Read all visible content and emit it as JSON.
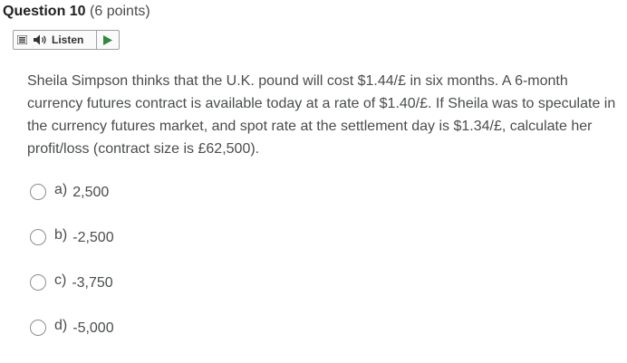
{
  "question": {
    "title": "Question 10",
    "points": "(6 points)",
    "text": "Sheila Simpson thinks that the U.K. pound will cost $1.44/£ in six months. A 6-month currency futures contract is available today at a rate of $1.40/£. If Sheila was to speculate in the currency futures market, and spot rate at the settlement day is $1.34/£, calculate her profit/loss (contract size is £62,500)."
  },
  "listen_bar": {
    "label": "Listen",
    "menu_icon": "menu-icon",
    "speaker_icon": "speaker-icon",
    "play_icon": "play-icon",
    "play_color": "#2e8b3c"
  },
  "options": [
    {
      "letter": "a)",
      "value": "2,500"
    },
    {
      "letter": "b)",
      "value": "-2,500"
    },
    {
      "letter": "c)",
      "value": "-3,750"
    },
    {
      "letter": "d)",
      "value": "-5,000"
    }
  ]
}
